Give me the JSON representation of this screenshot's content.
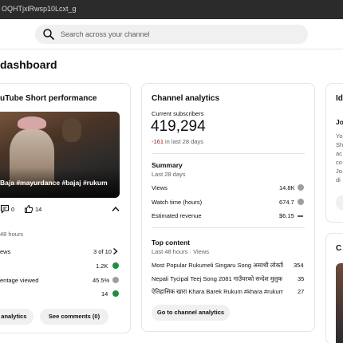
{
  "browser": {
    "url_fragment": "OQHTjxlRwsp10Lcxt_g"
  },
  "search": {
    "placeholder": "Search across your channel"
  },
  "page": {
    "title": "dashboard"
  },
  "short_perf": {
    "title": "uTube Short performance",
    "caption": "Baja #mayurdance #bajaj #rukum",
    "comments_count": "0",
    "likes_count": "14",
    "time_window": "48 hours",
    "rows": [
      {
        "label": "ews",
        "value": "3 of 10"
      },
      {
        "label": "",
        "value": "1.2K"
      },
      {
        "label": "entage viewed",
        "value": "45.5%"
      },
      {
        "label": "",
        "value": "14"
      }
    ],
    "analytics_btn": "o analytics",
    "comments_btn": "See comments (0)",
    "colors": {
      "up": "#1e8e3e",
      "neutral": "#9e9e9e"
    }
  },
  "channel": {
    "title": "Channel analytics",
    "subs_label": "Current subscribers",
    "subs_value": "419,294",
    "subs_change": "-161",
    "subs_change_suffix": "in last 28 days",
    "summary_title": "Summary",
    "summary_period": "Last 28 days",
    "summary": [
      {
        "label": "Views",
        "value": "14.8K"
      },
      {
        "label": "Watch time (hours)",
        "value": "674.7"
      },
      {
        "label": "Estimated revenue",
        "value": "$6.15"
      }
    ],
    "top_title": "Top content",
    "top_period": "Last 48 hours · Views",
    "top": [
      {
        "title": "Most Popular Rukumeli Singaru Song असाथी लोकप्रिय ...",
        "views": "354"
      },
      {
        "title": "Nepali Tycipal Teej Song 2081 गाउँघरको सन्देश मुलुक ...",
        "views": "35"
      },
      {
        "title": "ऐतिहासिक खारा Khara Barek Rukum #khara #rukum #...",
        "views": "27"
      }
    ],
    "go_btn": "Go to channel analytics",
    "colors": {
      "negative": "#cc0000"
    }
  },
  "side": {
    "card_title": "Id",
    "sub_label": "Jo",
    "lines": [
      "Yo",
      "Sh",
      "ac",
      "co",
      "Jo",
      "di"
    ],
    "card2_title": "C"
  }
}
